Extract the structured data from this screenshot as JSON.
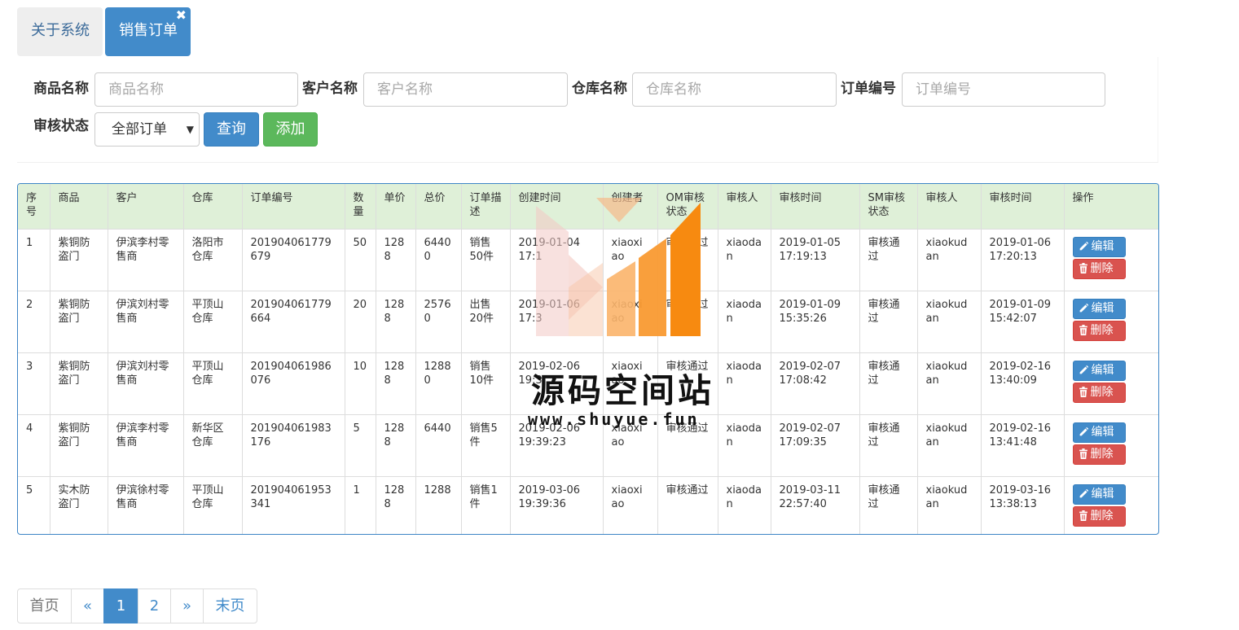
{
  "tabs": {
    "about": "关于系统",
    "orders": "销售订单",
    "close_glyph": "✖"
  },
  "search": {
    "product_label": "商品名称",
    "product_placeholder": "商品名称",
    "customer_label": "客户名称",
    "customer_placeholder": "客户名称",
    "warehouse_label": "仓库名称",
    "warehouse_placeholder": "仓库名称",
    "order_label": "订单编号",
    "order_placeholder": "订单编号",
    "status_label": "审核状态",
    "status_value": "全部订单",
    "query_button": "查询",
    "add_button": "添加"
  },
  "table": {
    "headers": [
      "序号",
      "商品",
      "客户",
      "仓库",
      "订单编号",
      "数量",
      "单价",
      "总价",
      "订单描述",
      "创建时间",
      "创建者",
      "OM审核状态",
      "审核人",
      "审核时间",
      "SM审核状态",
      "审核人",
      "审核时间",
      "操作"
    ],
    "edit_label": "编辑",
    "delete_label": "删除",
    "rows": [
      [
        "1",
        "紫铜防盗门",
        "伊滨李村零售商",
        "洛阳市仓库",
        "201904061779679",
        "50",
        "1288",
        "64400",
        "销售50件",
        "2019-01-04 17:1",
        "xiaoxiao",
        "审核通过",
        "xiaodan",
        "2019-01-05 17:19:13",
        "审核通过",
        "xiaokudan",
        "2019-01-06 17:20:13"
      ],
      [
        "2",
        "紫铜防盗门",
        "伊滨刘村零售商",
        "平顶山仓库",
        "201904061779664",
        "20",
        "1288",
        "25760",
        "出售20件",
        "2019-01-06 17:3",
        "xiaoxiao",
        "审核通过",
        "xiaodan",
        "2019-01-09 15:35:26",
        "审核通过",
        "xiaokudan",
        "2019-01-09 15:42:07"
      ],
      [
        "3",
        "紫铜防盗门",
        "伊滨刘村零售商",
        "平顶山仓库",
        "201904061986076",
        "10",
        "1288",
        "12880",
        "销售10件",
        "2019-02-06 19:3",
        "xiaoxiao",
        "审核通过",
        "xiaodan",
        "2019-02-07 17:08:42",
        "审核通过",
        "xiaokudan",
        "2019-02-16 13:40:09"
      ],
      [
        "4",
        "紫铜防盗门",
        "伊滨李村零售商",
        "新华区仓库",
        "201904061983176",
        "5",
        "1288",
        "6440",
        "销售5件",
        "2019-02-06 19:39:23",
        "xiaoxiao",
        "审核通过",
        "xiaodan",
        "2019-02-07 17:09:35",
        "审核通过",
        "xiaokudan",
        "2019-02-16 13:41:48"
      ],
      [
        "5",
        "实木防盗门",
        "伊滨徐村零售商",
        "平顶山仓库",
        "201904061953341",
        "1",
        "1288",
        "1288",
        "销售1件",
        "2019-03-06 19:39:36",
        "xiaoxiao",
        "审核通过",
        "xiaodan",
        "2019-03-11 22:57:40",
        "审核通过",
        "xiaokudan",
        "2019-03-16 13:38:13"
      ]
    ]
  },
  "pager": {
    "first": "首页",
    "prev": "«",
    "pages": [
      "1",
      "2"
    ],
    "next": "»",
    "last": "末页",
    "current": "1"
  },
  "watermark": {
    "title": "源码空间站",
    "url": "www.shuyue.fun"
  },
  "colors": {
    "primary": "#428bca",
    "success": "#5cb85c",
    "danger": "#d9534f",
    "header_bg": "#dff0d8"
  }
}
